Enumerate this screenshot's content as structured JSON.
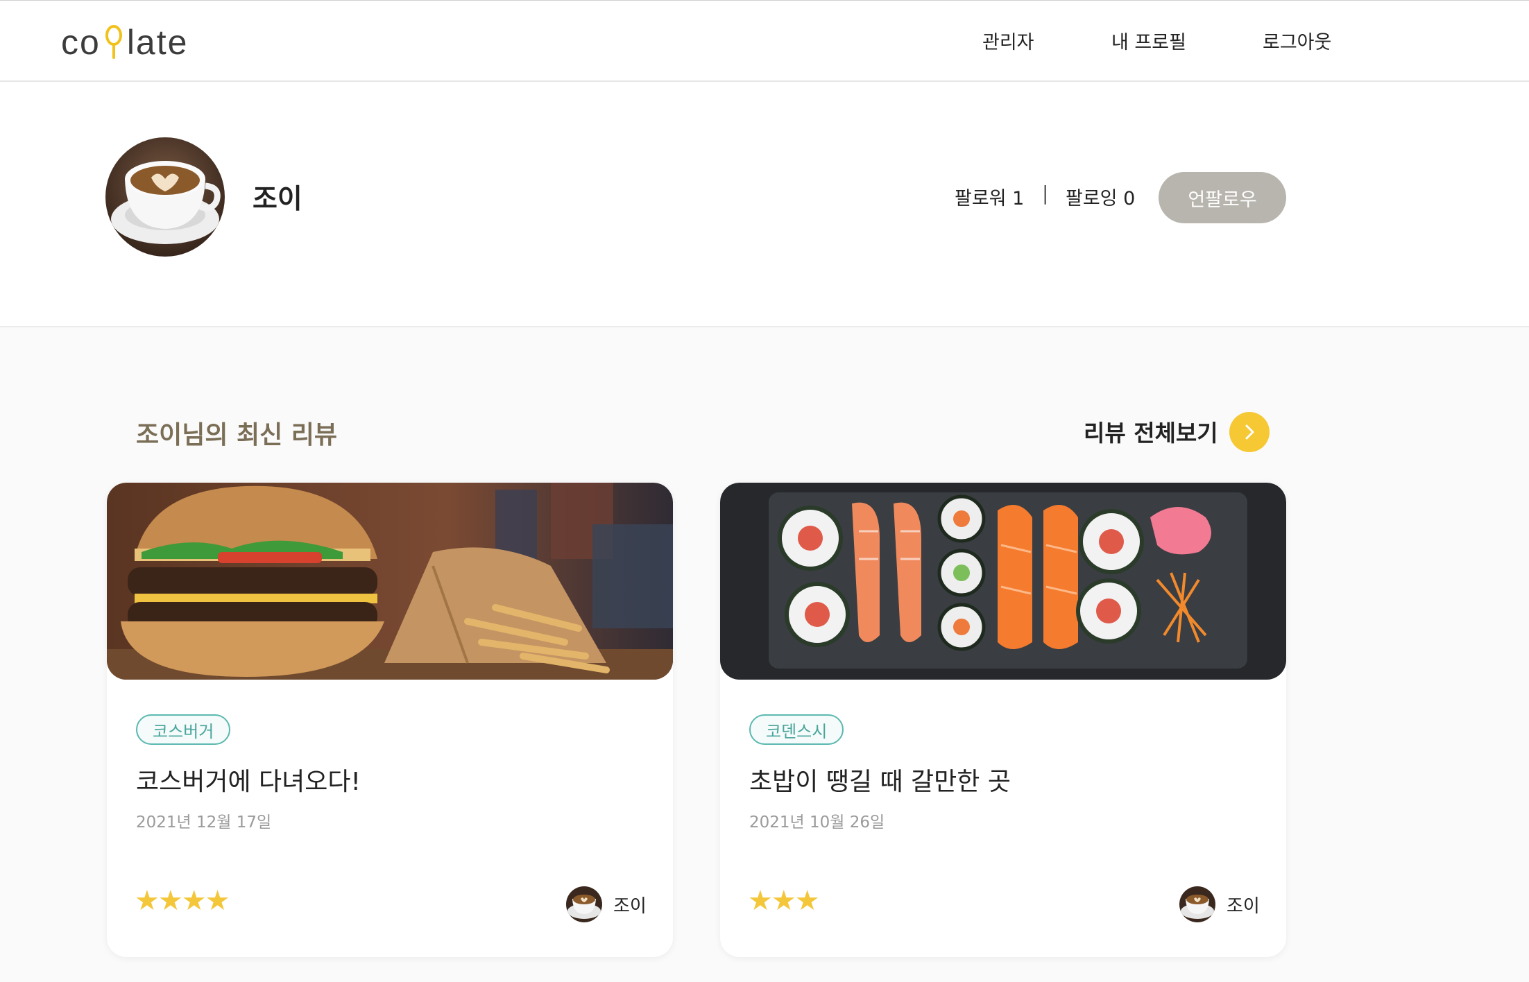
{
  "header": {
    "logo_prefix": "co",
    "logo_suffix": "late",
    "nav": [
      "관리자",
      "내 프로필",
      "로그아웃"
    ]
  },
  "profile": {
    "name": "조이",
    "followers": "팔로워 1",
    "separator": "|",
    "following": "팔로잉 0",
    "unfollow_label": "언팔로우"
  },
  "reviews_section": {
    "title": "조이님의 최신 리뷰",
    "see_all": "리뷰 전체보기"
  },
  "cards": [
    {
      "tag": "코스버거",
      "title": "코스버거에 다녀오다!",
      "date": "2021년 12월 17일",
      "stars": "★★★★",
      "rating": 4,
      "author": "조이",
      "image": "burger-photo"
    },
    {
      "tag": "코덴스시",
      "title": "초밥이 땡길 때 갈만한 곳",
      "date": "2021년 10월 26일",
      "stars": "★★★",
      "rating": 3,
      "author": "조이",
      "image": "sushi-photo"
    }
  ],
  "colors": {
    "accent_yellow": "#f5c834",
    "tag_teal": "#4aa59d",
    "unfollow_gray": "#b7b5ae",
    "section_title": "#7b6e57",
    "star": "#f4c63a"
  }
}
